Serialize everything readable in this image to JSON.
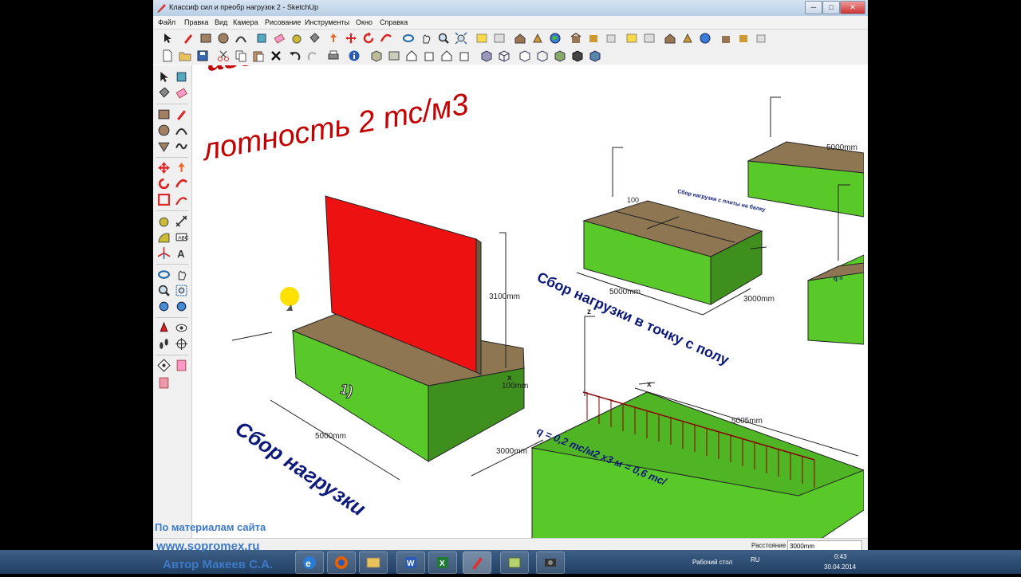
{
  "window": {
    "title": "Классиф сил и преобр нагрузок 2 - SketchUp",
    "minimize": "─",
    "maximize": "□",
    "close": "✕"
  },
  "menu": [
    "Файл",
    "Правка",
    "Вид",
    "Камера",
    "Рисование",
    "Инструменты",
    "Окно",
    "Справка"
  ],
  "scene": {
    "heading_top": "азоба",
    "heading_density": "лотность 2 тс/м3",
    "box1_label": "1)",
    "dim_5000_1": "5000mm",
    "dim_3000_1": "3000mm",
    "dim_3100": "3100mm",
    "dim_100": "100mm",
    "dim_5000_2": "5000mm",
    "dim_3000_2": "3000mm",
    "dim_100_b": "100",
    "dim_5000_3": "5000mm",
    "dim_5005": "5005mm",
    "axis_z_1": "z",
    "axis_z_2": "z",
    "axis_x_1": "x",
    "axis_x_2": "x",
    "text_load_point": "Сбор нагрузки в точку с полу",
    "text_load_big": "Сбор нагрузки",
    "text_formula": "q = 0,2 тс/м2 х3 м = 0,6 тс/",
    "text_small_right": "Сбор нагрузки с плиты на балку",
    "text_q_partial": "q =",
    "formula_partial": "q = 0,2 тс/"
  },
  "status": {
    "label": "Расстояние",
    "value": "3000mm"
  },
  "watermark": {
    "line1": "По материалам сайта",
    "line2": "www.sopromex.ru",
    "line3": "Автор Макеев С.А."
  },
  "taskbar": {
    "desktop_label": "Рабочий стол",
    "lang": "RU",
    "time": "0:43",
    "date": "30.04.2014"
  },
  "colors": {
    "green": "#59c92a",
    "green_dark": "#3f8f1e",
    "wood": "#8f7653",
    "red": "#ee1111",
    "text_blue": "#0d1a7a",
    "text_red": "#c40000"
  }
}
